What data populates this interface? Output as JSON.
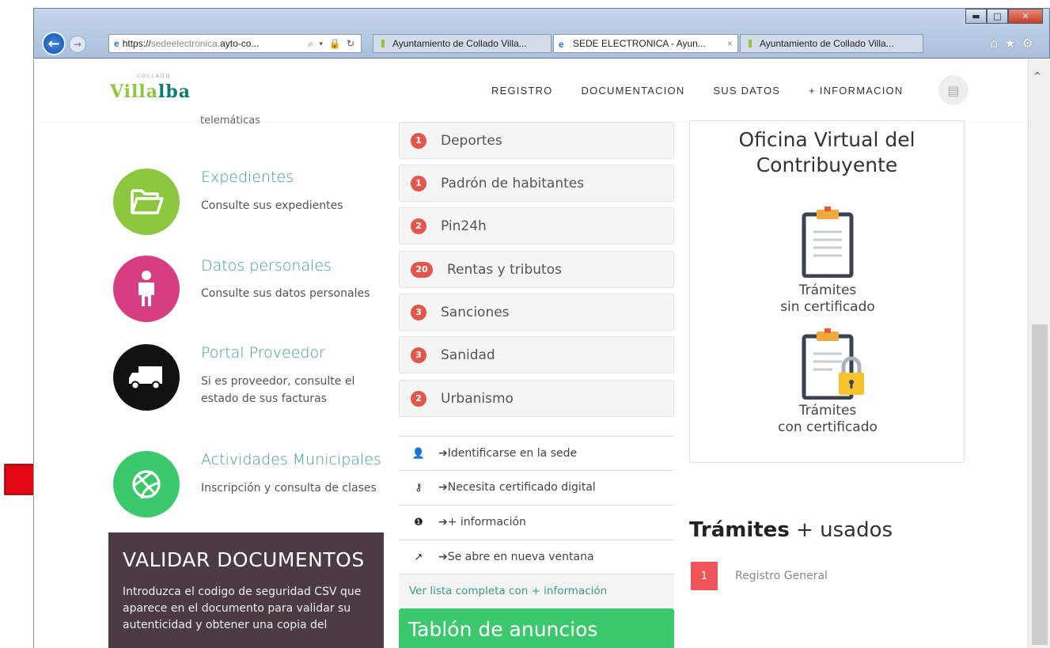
{
  "browser": {
    "address": {
      "scheme": "https://",
      "host_grey": "sedeelectronica.",
      "host": "ayto-co...",
      "controls": "⌕ ▾ 🔒 ↻"
    },
    "tabs": [
      {
        "label": "Ayuntamiento de Collado Villa..."
      },
      {
        "label": "SEDE ELECTRONICA - Ayun...",
        "close": "×"
      },
      {
        "label": "Ayuntamiento de Collado Villa..."
      }
    ],
    "window_buttons": {
      "minimize": "▬",
      "maximize": "□",
      "close": "✕"
    },
    "toolbar_icons": "⌂★⚙",
    "back": "←",
    "forward": "→",
    "scroll_up": "^"
  },
  "header": {
    "logo": {
      "pre": "Villa",
      "mid": "lb",
      "post": "a",
      "sub": "COLLADO"
    },
    "nav": [
      "REGISTRO",
      "DOCUMENTACION",
      "SUS DATOS",
      "+ INFORMACION"
    ]
  },
  "left": {
    "cut_text": "telemáticas",
    "services": [
      {
        "title": "Expedientes",
        "desc": "Consulte sus expedientes",
        "color": "#8dc63f",
        "icon": "folder-icon"
      },
      {
        "title": "Datos personales",
        "desc": "Consulte sus datos personales",
        "color": "#d63e81",
        "icon": "person-icon"
      },
      {
        "title": "Portal Proveedor",
        "desc": "Si es proveedor, consulte el estado de sus facturas",
        "color": "#111111",
        "icon": "truck-icon"
      },
      {
        "title": "Actividades Municipales",
        "desc": "Inscripción y consulta de clases",
        "color": "#3cc86c",
        "icon": "ball-icon"
      }
    ],
    "validar": {
      "title": "VALIDAR DOCUMENTOS",
      "text": "Introduzca el codigo de seguridad CSV que aparece en el documento para validar su autenticidad y obtener una copia del"
    }
  },
  "middle": {
    "categories": [
      {
        "count": "1",
        "label": "Deportes"
      },
      {
        "count": "1",
        "label": "Padrón de habitantes"
      },
      {
        "count": "2",
        "label": "Pin24h"
      },
      {
        "count": "20",
        "label": "Rentas y tributos"
      },
      {
        "count": "3",
        "label": "Sanciones"
      },
      {
        "count": "3",
        "label": "Sanidad"
      },
      {
        "count": "2",
        "label": "Urbanismo"
      }
    ],
    "legend": [
      {
        "icon": "user-icon",
        "glyph": "👤",
        "label": "➔Identificarse en la sede"
      },
      {
        "icon": "key-icon",
        "glyph": "⚷",
        "label": "➔Necesita certificado digital"
      },
      {
        "icon": "info-icon",
        "glyph": "❶",
        "label": "➔+ información"
      },
      {
        "icon": "external-link-icon",
        "glyph": "↗",
        "label": "➔Se abre en nueva ventana"
      }
    ],
    "ver_lista": "Ver lista completa con + información",
    "tablon": "Tablón de anuncios"
  },
  "right": {
    "oficina_title": "Oficina Virtual del Contribuyente",
    "sin_cert": {
      "line1": "Trámites",
      "line2": "sin certificado"
    },
    "con_cert": {
      "line1": "Trámites",
      "line2": "con certificado"
    },
    "tramites_bold": "Trámites",
    "tramites_rest": " + usados",
    "tramites_list": [
      {
        "num": "1",
        "label": "Registro General"
      }
    ]
  },
  "colors": {
    "accent": "#3a9c8f",
    "badge": "#e2574c",
    "green": "#3cc86c",
    "annotation_arrow": "#e30613"
  }
}
